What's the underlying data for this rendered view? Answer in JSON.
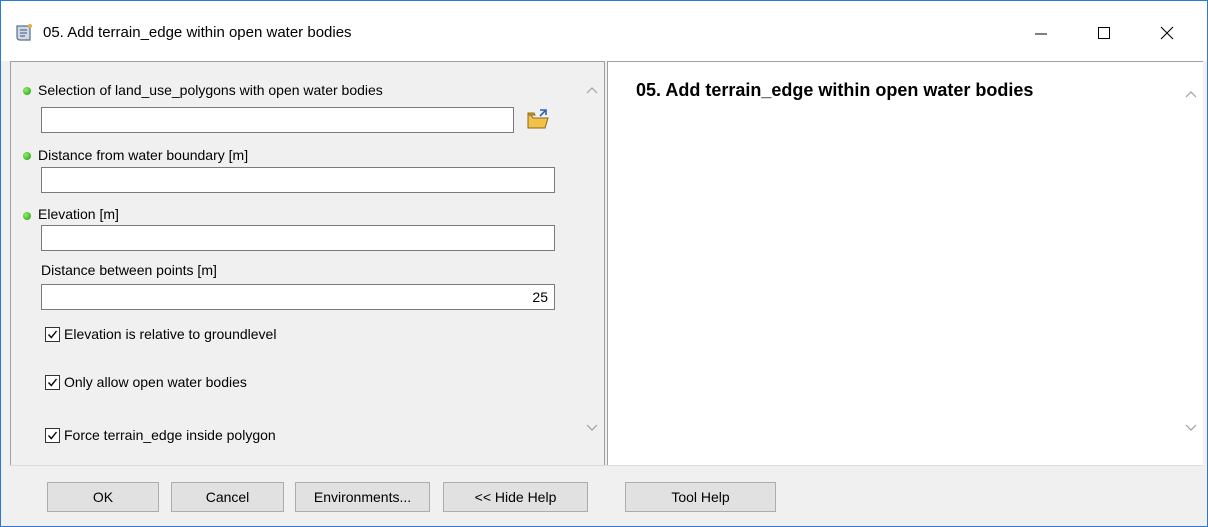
{
  "window": {
    "title": "05. Add terrain_edge within open water bodies",
    "icon": "toolbox-script-icon",
    "controls": {
      "minimize": "minimize-icon",
      "maximize": "maximize-icon",
      "close": "close-icon"
    }
  },
  "form": {
    "params": [
      {
        "label": "Selection of land_use_polygons with open water bodies",
        "value": "",
        "required": true
      },
      {
        "label": "Distance from water boundary [m]",
        "value": "",
        "required": true
      },
      {
        "label": "Elevation [m]",
        "value": "",
        "required": true
      },
      {
        "label": "Distance between points [m]",
        "value": "25",
        "required": false
      }
    ],
    "checkboxes": [
      {
        "label": "Elevation is relative to groundlevel",
        "checked": true
      },
      {
        "label": "Only allow open water bodies",
        "checked": true
      },
      {
        "label": "Force terrain_edge inside polygon",
        "checked": true
      }
    ]
  },
  "help": {
    "title": "05. Add terrain_edge within open water bodies"
  },
  "buttons": {
    "ok": "OK",
    "cancel": "Cancel",
    "environments": "Environments...",
    "hide_help": "<< Hide Help",
    "tool_help": "Tool Help"
  },
  "colors": {
    "required_dot": "#1d9a17",
    "window_border": "#2b79d0"
  }
}
